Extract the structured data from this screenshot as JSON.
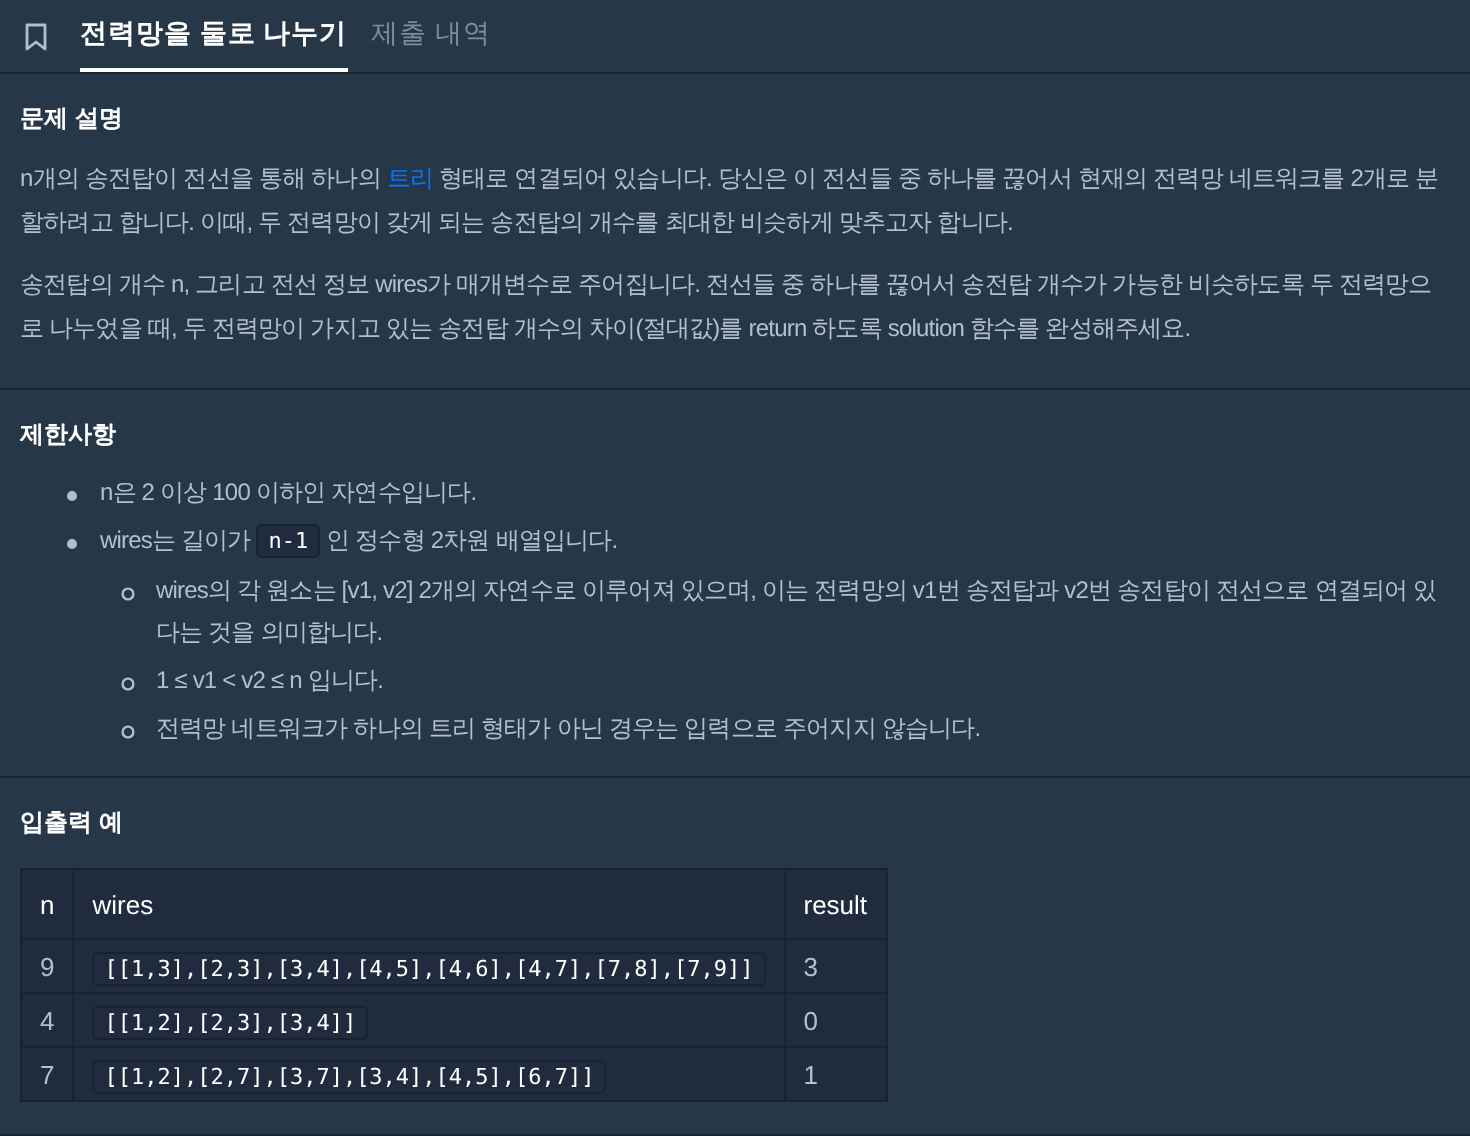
{
  "tabs": [
    {
      "label": "전력망을 둘로 나누기",
      "selected": true
    },
    {
      "label": "제출 내역",
      "selected": false
    }
  ],
  "description": {
    "heading": "문제 설명",
    "paragraphs": [
      {
        "before": "n개의 송전탑이 전선을 통해 하나의 ",
        "link": "트리",
        "after": " 형태로 연결되어 있습니다. 당신은 이 전선들 중 하나를 끊어서 현재의 전력망 네트워크를 2개로 분할하려고 합니다. 이때, 두 전력망이 갖게 되는 송전탑의 개수를 최대한 비슷하게 맞추고자 합니다."
      },
      {
        "before": "송전탑의 개수 n, 그리고 전선 정보 wires가 매개변수로 주어집니다. 전선들 중 하나를 끊어서 송전탑 개수가 가능한 비슷하도록 두 전력망으로 나누었을 때, 두 전력망이 가지고 있는 송전탑 개수의 차이(절대값)를 return 하도록 solution 함수를 완성해주세요."
      }
    ]
  },
  "constraints": {
    "heading": "제한사항",
    "items": [
      {
        "text": "n은 2 이상 100 이하인 자연수입니다."
      },
      {
        "text": "wires는 길이가 ",
        "code": "n-1",
        "after": " 인 정수형 2차원 배열입니다.",
        "children": [
          {
            "text": "wires의 각 원소는 [v1, v2] 2개의 자연수로 이루어져 있으며, 이는 전력망의 v1번 송전탑과 v2번 송전탑이 전선으로 연결되어 있다는 것을 의미합니다."
          },
          {
            "text": "1 ≤ v1 < v2 ≤ n 입니다."
          },
          {
            "text": "전력망 네트워크가 하나의 트리 형태가 아닌 경우는 입력으로 주어지지 않습니다."
          }
        ]
      }
    ]
  },
  "examples": {
    "heading": "입출력 예",
    "columns": [
      "n",
      "wires",
      "result"
    ],
    "rows": [
      [
        "9",
        "[[1,3],[2,3],[3,4],[4,5],[4,6],[4,7],[7,8],[7,9]]",
        "3"
      ],
      [
        "4",
        "[[1,2],[2,3],[3,4]]",
        "0"
      ],
      [
        "7",
        "[[1,2],[2,7],[3,7],[3,4],[4,5],[6,7]]",
        "1"
      ]
    ]
  }
}
